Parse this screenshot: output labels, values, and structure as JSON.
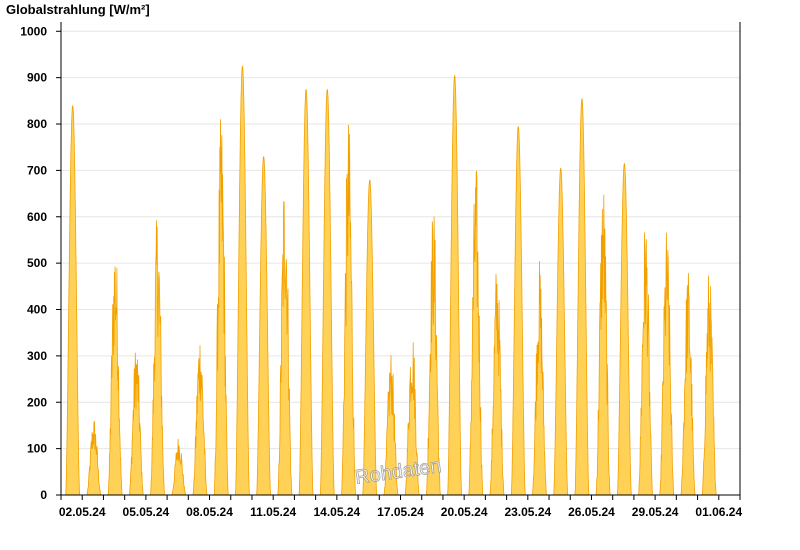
{
  "chart_data": {
    "type": "area",
    "title": "Globalstrahlung [W/m²]",
    "xlabel": "",
    "ylabel": "Globalstrahlung [W/m²]",
    "ylim": [
      0,
      1020
    ],
    "yticks": [
      0,
      100,
      200,
      300,
      400,
      500,
      600,
      700,
      800,
      900,
      1000
    ],
    "xlim": [
      "2024-05-01",
      "2024-06-02"
    ],
    "xtick_labels": [
      "02.05.24",
      "05.05.24",
      "08.05.24",
      "11.05.24",
      "14.05.24",
      "17.05.24",
      "20.05.24",
      "23.05.24",
      "26.05.24",
      "29.05.24",
      "01.06.24"
    ],
    "grid": true,
    "fill_color": "#ffd257",
    "line_color": "#f2a000",
    "watermark": "Rohdaten",
    "series": [
      {
        "name": "",
        "daily_peaks": [
          {
            "date": "2024-05-01",
            "peak": 840
          },
          {
            "date": "2024-05-02",
            "peak": 170
          },
          {
            "date": "2024-05-03",
            "peak": 570
          },
          {
            "date": "2024-05-04",
            "peak": 335
          },
          {
            "date": "2024-05-05",
            "peak": 620
          },
          {
            "date": "2024-05-06",
            "peak": 130
          },
          {
            "date": "2024-05-07",
            "peak": 360
          },
          {
            "date": "2024-05-08",
            "peak": 830
          },
          {
            "date": "2024-05-09",
            "peak": 925
          },
          {
            "date": "2024-05-10",
            "peak": 730
          },
          {
            "date": "2024-05-11",
            "peak": 720
          },
          {
            "date": "2024-05-12",
            "peak": 875
          },
          {
            "date": "2024-05-13",
            "peak": 875
          },
          {
            "date": "2024-05-14",
            "peak": 825
          },
          {
            "date": "2024-05-15",
            "peak": 680
          },
          {
            "date": "2024-05-16",
            "peak": 315
          },
          {
            "date": "2024-05-17",
            "peak": 370
          },
          {
            "date": "2024-05-18",
            "peak": 635
          },
          {
            "date": "2024-05-19",
            "peak": 905
          },
          {
            "date": "2024-05-20",
            "peak": 725
          },
          {
            "date": "2024-05-21",
            "peak": 515
          },
          {
            "date": "2024-05-22",
            "peak": 795
          },
          {
            "date": "2024-05-23",
            "peak": 510
          },
          {
            "date": "2024-05-24",
            "peak": 705
          },
          {
            "date": "2024-05-25",
            "peak": 855
          },
          {
            "date": "2024-05-26",
            "peak": 695
          },
          {
            "date": "2024-05-27",
            "peak": 715
          },
          {
            "date": "2024-05-28",
            "peak": 610
          },
          {
            "date": "2024-05-29",
            "peak": 580
          },
          {
            "date": "2024-05-30",
            "peak": 495
          },
          {
            "date": "2024-05-31",
            "peak": 495
          }
        ]
      }
    ]
  }
}
